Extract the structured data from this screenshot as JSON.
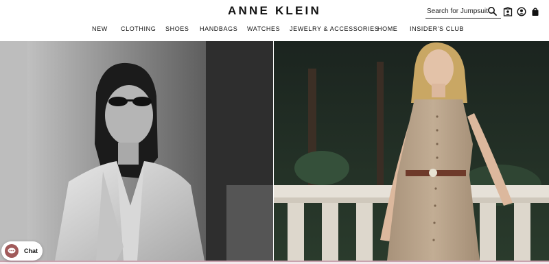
{
  "brand": {
    "logo_text": "ANNE KLEIN"
  },
  "search": {
    "placeholder": "Search for Jumpsuit"
  },
  "nav": {
    "items": [
      {
        "label": "NEW"
      },
      {
        "label": "CLOTHING"
      },
      {
        "label": "SHOES"
      },
      {
        "label": "HANDBAGS"
      },
      {
        "label": "WATCHES"
      },
      {
        "label": "JEWELRY & ACCESSORIES"
      },
      {
        "label": "HOME"
      },
      {
        "label": "INSIDER'S CLUB"
      }
    ]
  },
  "utility_icons": [
    "search-icon",
    "store-locator-icon",
    "account-icon",
    "bag-icon"
  ],
  "chat": {
    "label": "Chat",
    "badge_color": "#a15a5a"
  },
  "colors": {
    "accent": "#c9a2ae",
    "text": "#111111",
    "background": "#ffffff"
  }
}
